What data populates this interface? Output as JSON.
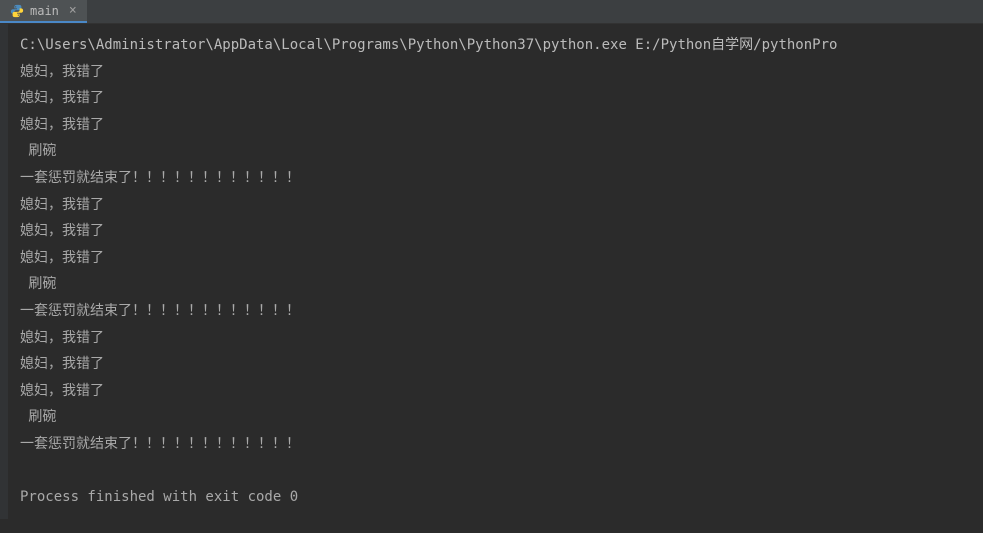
{
  "tab": {
    "label": "main",
    "close_symbol": "×"
  },
  "console": {
    "command": "C:\\Users\\Administrator\\AppData\\Local\\Programs\\Python\\Python37\\python.exe E:/Python自学网/pythonPro",
    "lines": [
      "媳妇，我错了",
      "媳妇，我错了",
      "媳妇，我错了",
      " 刷碗",
      "一套惩罚就结束了！！！！！！！！！！！！",
      "媳妇，我错了",
      "媳妇，我错了",
      "媳妇，我错了",
      " 刷碗",
      "一套惩罚就结束了！！！！！！！！！！！！",
      "媳妇，我错了",
      "媳妇，我错了",
      "媳妇，我错了",
      " 刷碗",
      "一套惩罚就结束了！！！！！！！！！！！！",
      "",
      "Process finished with exit code 0"
    ]
  }
}
